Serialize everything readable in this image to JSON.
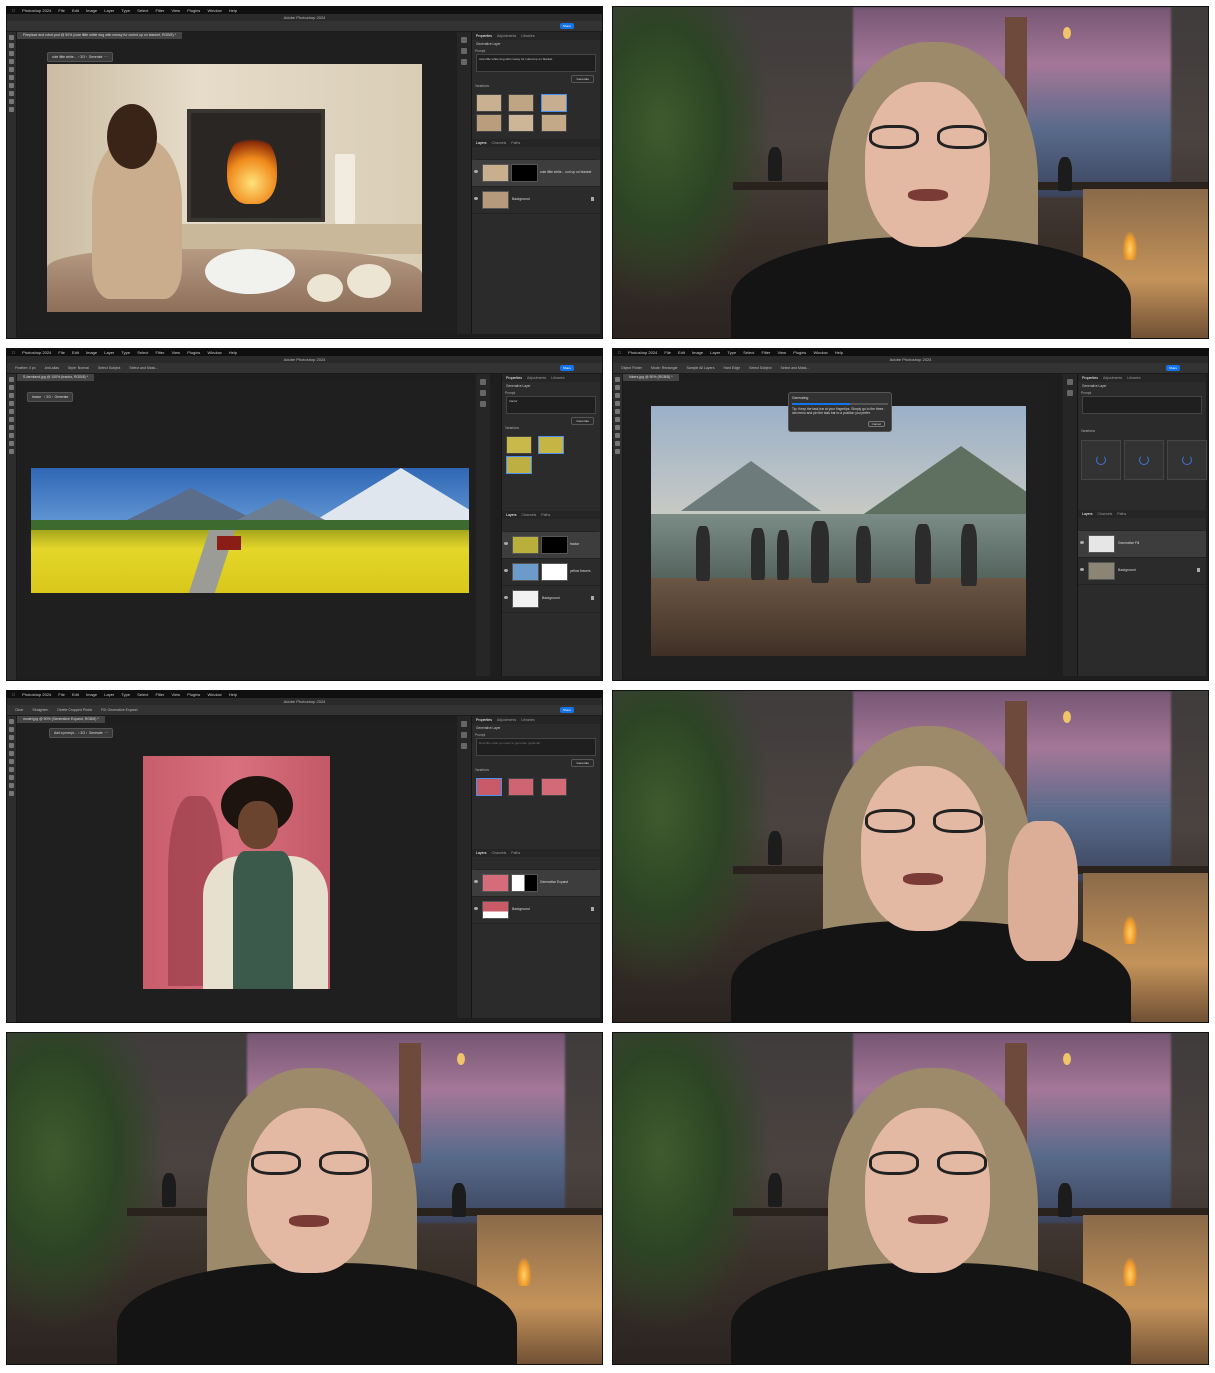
{
  "photoshop": {
    "app_name": "Photoshop 2024",
    "menu": [
      "File",
      "Edit",
      "Image",
      "Layer",
      "Type",
      "Select",
      "Filter",
      "3D",
      "View",
      "Plugins",
      "Window",
      "Help"
    ],
    "window_title": "Adobe Photoshop 2024",
    "share_label": "Share"
  },
  "panels": {
    "fireplace": {
      "doc_tab": "Fireplace and robot.psd @ 50% (cute little white dog with messy fur curled up on blanket, RGB/8) *",
      "context_prompt": "cute little white...",
      "context_counter": "3/3",
      "generate_label": "Generate",
      "tabs": [
        "Properties",
        "Adjustments",
        "Libraries"
      ],
      "layer_type": "Generative Layer",
      "prompt_label": "Prompt",
      "prompt_text": "cute little white dog with messy fur curled up on blanket",
      "variations_label": "Variations",
      "layer_tabs": [
        "Layers",
        "Channels",
        "Paths"
      ],
      "layers": [
        "cute little white... curl up on blanket",
        "Background"
      ]
    },
    "panorama": {
      "doc_tab": "S-farmland.jpg @ 100% (tractor, RGB/8) *",
      "context_prompt": "tractor",
      "context_counter": "3/3",
      "generate_label": "Generate",
      "options_items": [
        "Feather: 0 px",
        "Anti-alias",
        "Style: Normal",
        "Select Subject",
        "Select and Mask..."
      ],
      "tabs": [
        "Properties",
        "Adjustments",
        "Libraries"
      ],
      "layer_type": "Generative Layer",
      "prompt_label": "Prompt",
      "prompt_text": "tractor",
      "variations_label": "Variations",
      "layer_tabs": [
        "Layers",
        "Channels",
        "Paths"
      ],
      "layers": [
        "tractor",
        "yellow flowers",
        "Background"
      ]
    },
    "hikers": {
      "doc_tab": "hikers.jpg @ 50% (RGB/8) *",
      "options_items": [
        "Object Finder",
        "Mode: Rectangle",
        "Sample All Layers",
        "Hard Edge",
        "Select Subject",
        "Select and Mask..."
      ],
      "dialog_title": "Generating",
      "dialog_tip": "Tip:",
      "dialog_text": "Keep the task bar at your fingertips. Simply go to the three-dot menu and pin the task bar to a position you prefer.",
      "dialog_cancel": "Cancel",
      "tabs": [
        "Properties",
        "Adjustments",
        "Libraries"
      ],
      "layer_type": "Generative Layer",
      "prompt_label": "Prompt",
      "variations_label": "Variations",
      "layer_tabs": [
        "Layers",
        "Channels",
        "Paths"
      ],
      "layers": [
        "Generative Fill",
        "Background"
      ]
    },
    "portrait": {
      "doc_tab": "model.jpg @ 50% (Generative Expand, RGB/8) *",
      "context_prompt": "Add a prompt...",
      "context_counter": "3/3",
      "generate_label": "Generate",
      "options_items": [
        "Clear",
        "Straighten",
        "Delete Cropped Pixels",
        "Fill: Generative Expand"
      ],
      "tabs": [
        "Properties",
        "Adjustments",
        "Libraries"
      ],
      "layer_type": "Generative Layer",
      "prompt_label": "Prompt",
      "prompt_text": "Describe what you want to generate (optional)",
      "variations_label": "Variations",
      "layer_tabs": [
        "Layers",
        "Channels",
        "Paths"
      ],
      "layers": [
        "Generative Expand",
        "Background"
      ]
    }
  },
  "colors": {
    "ps_bg": "#1e1e1e",
    "accent": "#1473e6",
    "selection": "#4b8ff0"
  }
}
